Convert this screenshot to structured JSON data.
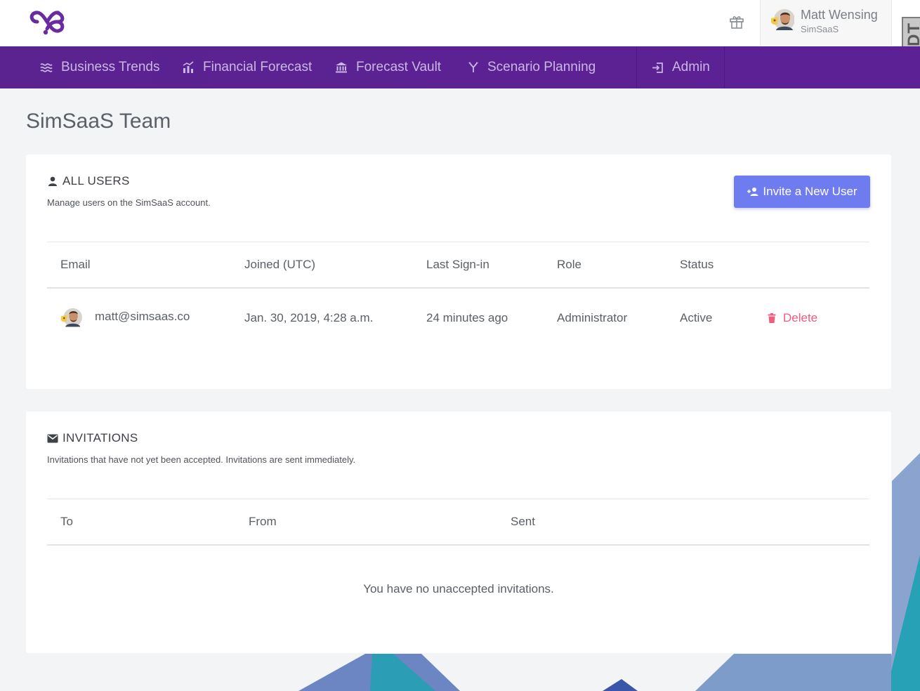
{
  "user": {
    "name": "Matt Wensing",
    "org": "SimSaaS"
  },
  "corner_tab": "DoDT",
  "nav": {
    "items": [
      {
        "label": "Business Trends"
      },
      {
        "label": "Financial Forecast"
      },
      {
        "label": "Forecast Vault"
      },
      {
        "label": "Scenario Planning"
      },
      {
        "label": "Admin"
      }
    ]
  },
  "page_title": "SimSaaS Team",
  "users_card": {
    "title": "ALL USERS",
    "subtitle": "Manage users on the SimSaaS account.",
    "invite_button": "Invite a New User",
    "columns": [
      "Email",
      "Joined (UTC)",
      "Last Sign-in",
      "Role",
      "Status"
    ],
    "rows": [
      {
        "email": "matt@simsaas.co",
        "joined": "Jan. 30, 2019, 4:28 a.m.",
        "last_sign_in": "24 minutes ago",
        "role": "Administrator",
        "status": "Active",
        "action": "Delete"
      }
    ]
  },
  "invitations_card": {
    "title": "INVITATIONS",
    "subtitle": "Invitations that have not yet been accepted. Invitations are sent immediately.",
    "columns": [
      "To",
      "From",
      "Sent"
    ],
    "empty_message": "You have no unaccepted invitations."
  },
  "colors": {
    "nav_bg": "#5b2294",
    "nav_text": "#c9b8e6",
    "brand": "#6a2aa0",
    "primary_button": "#6f7cf0",
    "danger": "#ee5d7e"
  },
  "icons": {
    "logo": "infinity-logo-icon",
    "gift": "gift-icon",
    "nav": [
      "trends-icon",
      "bar-chart-icon",
      "bank-icon",
      "branch-icon",
      "sign-in-icon"
    ],
    "users": "person-icon",
    "invite": "person-add-icon",
    "delete": "trash-icon",
    "invitations": "mail-icon"
  }
}
